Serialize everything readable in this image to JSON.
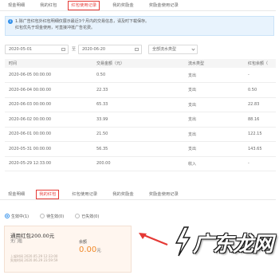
{
  "top_tabs": [
    "现金明细",
    "我的红包",
    "红包使用记录",
    "我的奖励金",
    "奖励金使用记录"
  ],
  "notice": {
    "line1": "1.除广告红包外红包明细仅展示最近3个月内的交易信息，请及时下载保存。",
    "line2": "红包优先于现金使用，可直接冲抵广告花费。"
  },
  "filters": {
    "start_date": "2020-05-01",
    "separator": "至",
    "end_date": "2020-06-20",
    "type_select": "全部流水类型"
  },
  "table": {
    "headers": [
      "时间",
      "交易金额（元）",
      "流水类型",
      "红包余额（"
    ],
    "rows": [
      [
        "2020-06-05 00:00:00",
        "0.50",
        "支出",
        "-"
      ],
      [
        "2020-06-04 00:00:00",
        "22.33",
        "支出",
        "0.50"
      ],
      [
        "2020-06-03 00:00:00",
        "65.33",
        "支出",
        "22.83"
      ],
      [
        "2020-06-02 00:00:00",
        "33.99",
        "支出",
        "88.16"
      ],
      [
        "2020-06-01 00:00:00",
        "21.50",
        "支出",
        "122.15"
      ],
      [
        "2020-05-31 00:00:00",
        "56.35",
        "支出",
        "143.65"
      ],
      [
        "2020-05-29 12:33:00",
        "200.00",
        "收入",
        "-"
      ]
    ]
  },
  "bottom_tabs": [
    "现金明细",
    "我的红包",
    "红包使用记录",
    "我的奖励金",
    "奖励金使用记录"
  ],
  "status_filter": [
    "生效中(1)",
    "待生效(0)",
    "已失效(0)"
  ],
  "coupon": {
    "title": "通用红包200.00元",
    "condition": "无门槛",
    "date1": "上架时间 2020.05.29 12:33:00",
    "date2": "失效时间 2020.06.29 23:59:59",
    "remaining_label": "余额",
    "remaining_value": "0.00",
    "remaining_unit": "元"
  },
  "watermark": "广东龙网",
  "colors": {
    "accent_red": "#e53935",
    "info_blue": "#2f8eea",
    "coupon_orange": "#f08a2b"
  }
}
